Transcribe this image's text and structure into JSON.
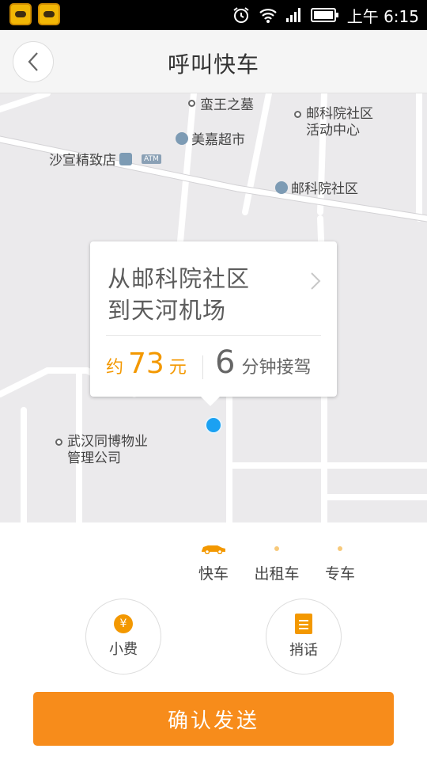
{
  "status_bar": {
    "time": "上午 6:15",
    "icons": [
      "alarm-icon",
      "wifi-icon",
      "signal-icon",
      "battery-icon"
    ]
  },
  "header": {
    "title": "呼叫快车",
    "back_icon": "chevron-left-icon"
  },
  "map": {
    "pois": [
      {
        "name": "蛮王之墓",
        "icon": "poi-dot-icon"
      },
      {
        "name": "美嘉超市",
        "icon": "shopping-cart-icon"
      },
      {
        "name": "沙宣精致店",
        "icon": "bank-icon",
        "badge": "ATM"
      },
      {
        "name": "邮科院社区\n活动中心",
        "icon": "poi-dot-icon"
      },
      {
        "name": "邮科院社区",
        "icon": "home-icon"
      },
      {
        "name": "武汉同博物业\n管理公司",
        "icon": "poi-dot-icon"
      }
    ]
  },
  "trip_card": {
    "from": "从邮科院社区",
    "to": "到天河机场",
    "price_prefix": "约",
    "price_value": "73",
    "price_unit": "元",
    "eta_value": "6",
    "eta_unit": "分钟接驾"
  },
  "car_types": [
    {
      "label": "快车",
      "selected": true
    },
    {
      "label": "出租车",
      "selected": false
    },
    {
      "label": "专车",
      "selected": false
    }
  ],
  "actions": {
    "tip_label": "小费",
    "tip_symbol": "¥",
    "message_label": "捎话"
  },
  "confirm_button": "确认发送",
  "colors": {
    "accent": "#f78c1b",
    "location_dot": "#1ba1f2",
    "map_bg": "#ebeaec"
  }
}
